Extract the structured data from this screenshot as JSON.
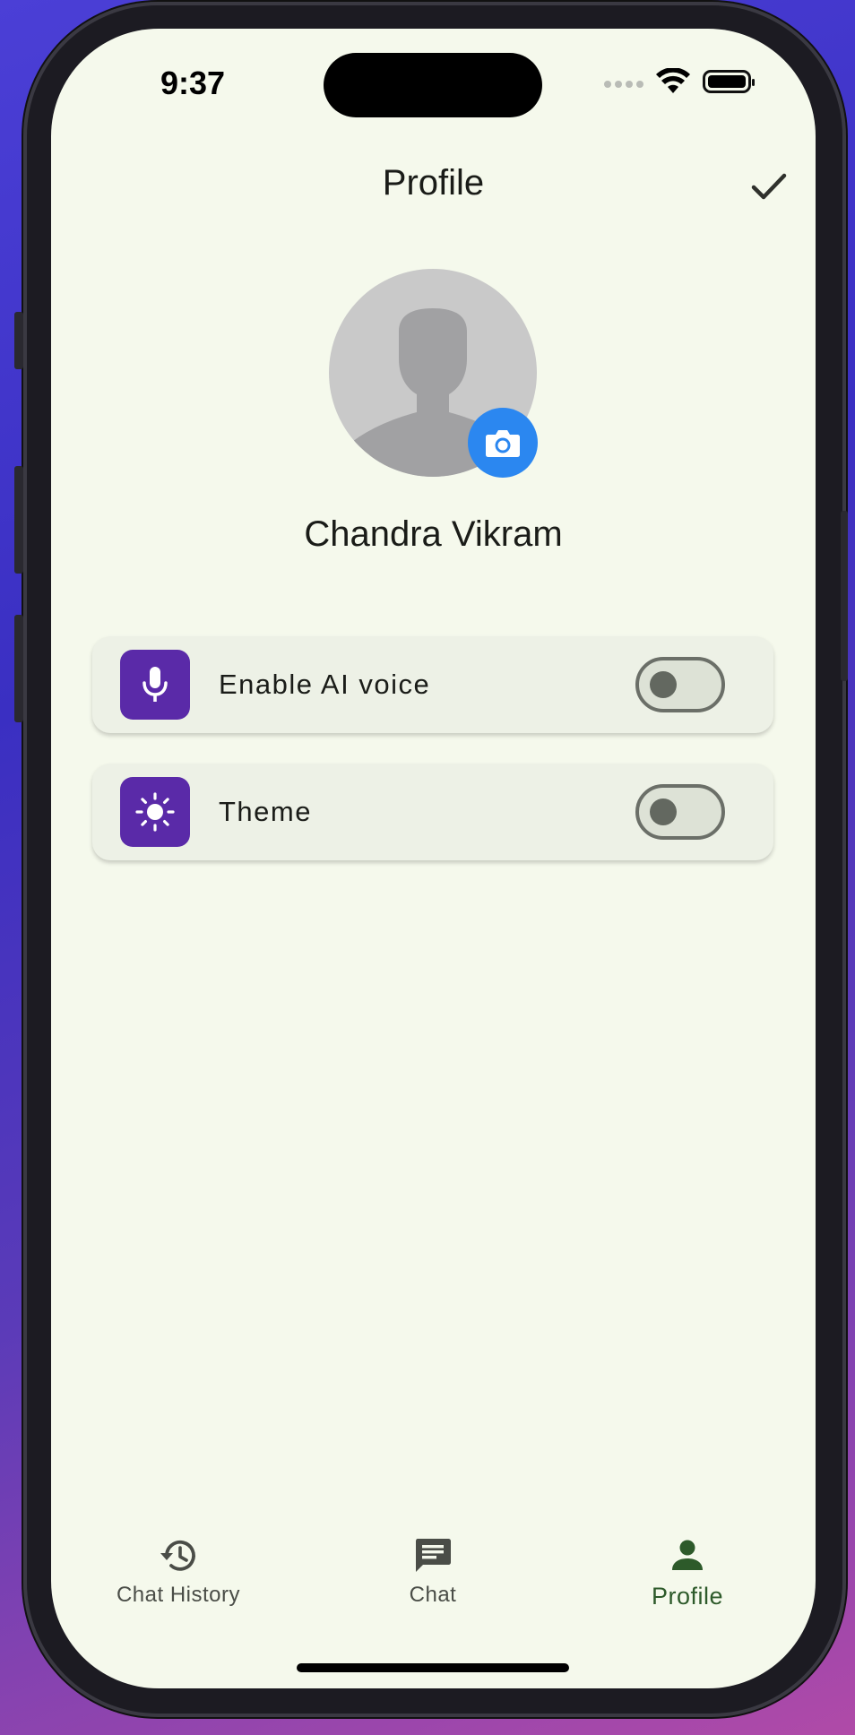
{
  "status_bar": {
    "time": "9:37"
  },
  "header": {
    "title": "Profile",
    "confirm_icon": "check-icon"
  },
  "profile": {
    "avatar_icon": "person-silhouette",
    "camera_icon": "camera-icon",
    "name": "Chandra Vikram"
  },
  "settings": [
    {
      "label": "Enable AI voice",
      "icon": "microphone-icon",
      "enabled": false
    },
    {
      "label": "Theme",
      "icon": "sun-icon",
      "enabled": false
    }
  ],
  "bottom_nav": {
    "items": [
      {
        "label": "Chat History",
        "icon": "history-icon",
        "active": false
      },
      {
        "label": "Chat",
        "icon": "chat-icon",
        "active": false
      },
      {
        "label": "Profile",
        "icon": "person-icon",
        "active": true
      }
    ]
  },
  "colors": {
    "background": "#f5f9ec",
    "card": "#edf1e6",
    "setting_icon_bg": "#5a2aa8",
    "camera_button": "#2b87f0",
    "active_nav": "#2d5a2a"
  }
}
